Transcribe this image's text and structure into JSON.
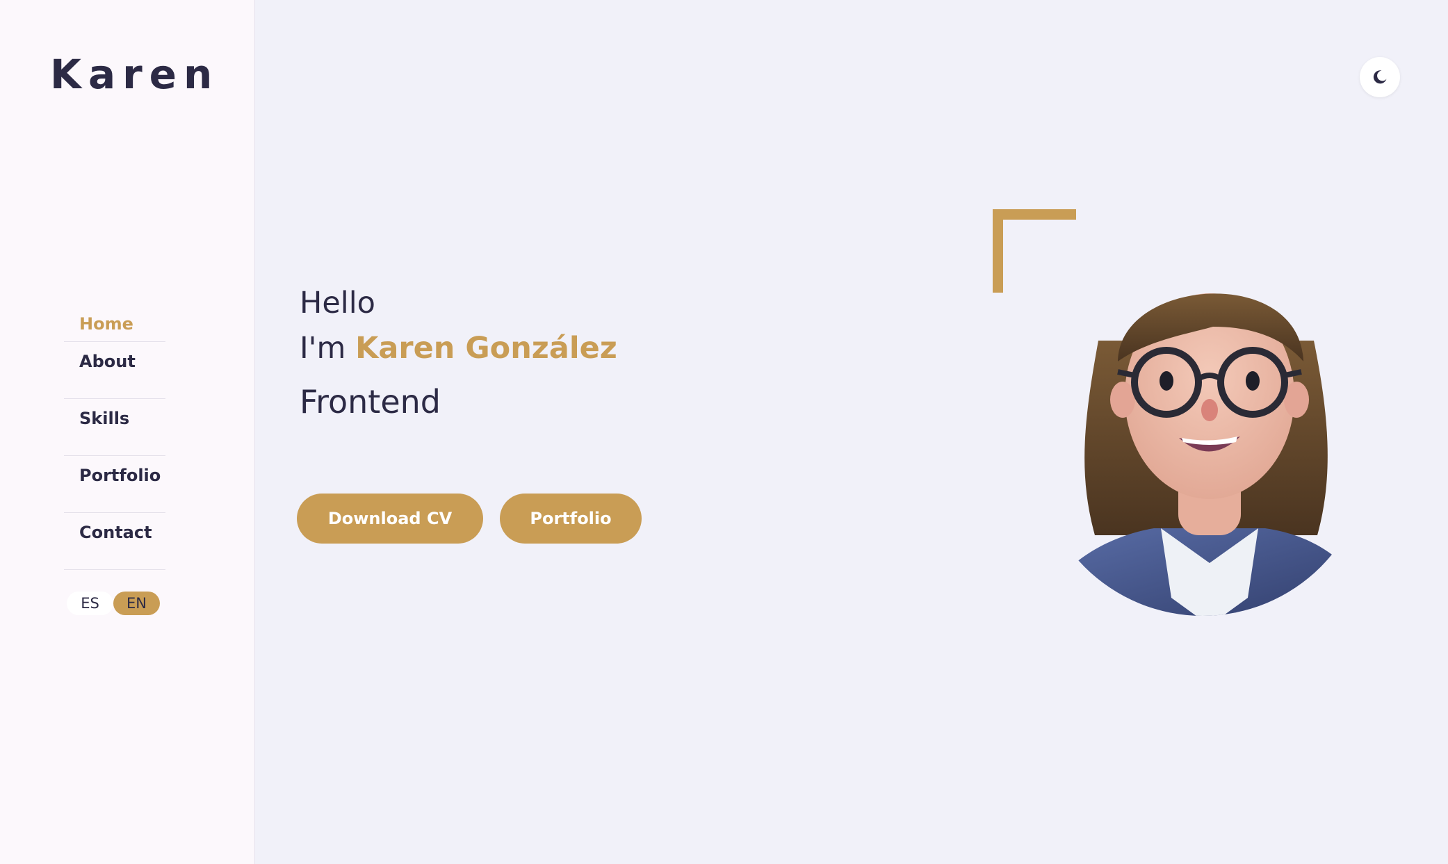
{
  "logo": "Karen",
  "nav": {
    "items": [
      {
        "label": "Home",
        "active": true
      },
      {
        "label": "About",
        "active": false
      },
      {
        "label": "Skills",
        "active": false
      },
      {
        "label": "Portfolio",
        "active": false
      },
      {
        "label": "Contact",
        "active": false
      }
    ]
  },
  "lang": {
    "options": [
      "ES",
      "EN"
    ],
    "selected": "EN"
  },
  "theme_toggle": {
    "icon": "moon-icon"
  },
  "hero": {
    "greeting": "Hello",
    "intro": "I'm",
    "name": "Karen González",
    "role": "Frontend",
    "download_label": "Download CV",
    "portfolio_label": "Portfolio"
  },
  "colors": {
    "accent": "#c99d55",
    "text": "#2c2a45",
    "background": "#f1f1f9",
    "sidebar": "#fcf8fc"
  }
}
